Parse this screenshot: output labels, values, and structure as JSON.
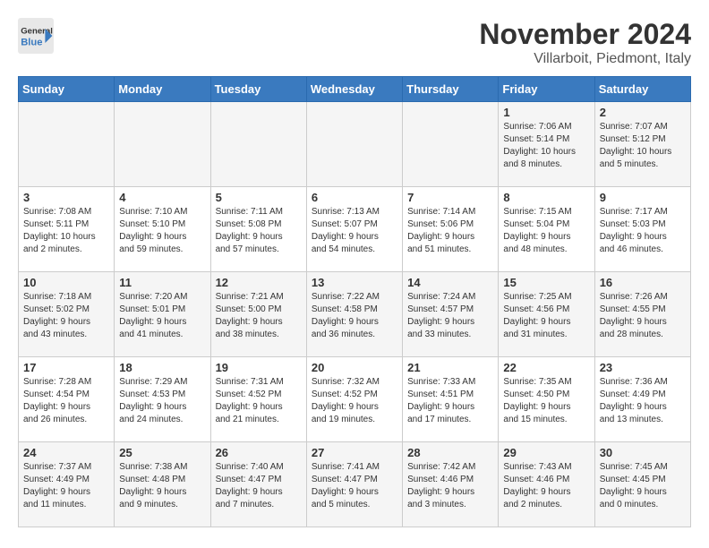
{
  "logo": {
    "text_general": "General",
    "text_blue": "Blue"
  },
  "title": "November 2024",
  "subtitle": "Villarboit, Piedmont, Italy",
  "weekdays": [
    "Sunday",
    "Monday",
    "Tuesday",
    "Wednesday",
    "Thursday",
    "Friday",
    "Saturday"
  ],
  "weeks": [
    [
      {
        "day": "",
        "info": ""
      },
      {
        "day": "",
        "info": ""
      },
      {
        "day": "",
        "info": ""
      },
      {
        "day": "",
        "info": ""
      },
      {
        "day": "",
        "info": ""
      },
      {
        "day": "1",
        "info": "Sunrise: 7:06 AM\nSunset: 5:14 PM\nDaylight: 10 hours\nand 8 minutes."
      },
      {
        "day": "2",
        "info": "Sunrise: 7:07 AM\nSunset: 5:12 PM\nDaylight: 10 hours\nand 5 minutes."
      }
    ],
    [
      {
        "day": "3",
        "info": "Sunrise: 7:08 AM\nSunset: 5:11 PM\nDaylight: 10 hours\nand 2 minutes."
      },
      {
        "day": "4",
        "info": "Sunrise: 7:10 AM\nSunset: 5:10 PM\nDaylight: 9 hours\nand 59 minutes."
      },
      {
        "day": "5",
        "info": "Sunrise: 7:11 AM\nSunset: 5:08 PM\nDaylight: 9 hours\nand 57 minutes."
      },
      {
        "day": "6",
        "info": "Sunrise: 7:13 AM\nSunset: 5:07 PM\nDaylight: 9 hours\nand 54 minutes."
      },
      {
        "day": "7",
        "info": "Sunrise: 7:14 AM\nSunset: 5:06 PM\nDaylight: 9 hours\nand 51 minutes."
      },
      {
        "day": "8",
        "info": "Sunrise: 7:15 AM\nSunset: 5:04 PM\nDaylight: 9 hours\nand 48 minutes."
      },
      {
        "day": "9",
        "info": "Sunrise: 7:17 AM\nSunset: 5:03 PM\nDaylight: 9 hours\nand 46 minutes."
      }
    ],
    [
      {
        "day": "10",
        "info": "Sunrise: 7:18 AM\nSunset: 5:02 PM\nDaylight: 9 hours\nand 43 minutes."
      },
      {
        "day": "11",
        "info": "Sunrise: 7:20 AM\nSunset: 5:01 PM\nDaylight: 9 hours\nand 41 minutes."
      },
      {
        "day": "12",
        "info": "Sunrise: 7:21 AM\nSunset: 5:00 PM\nDaylight: 9 hours\nand 38 minutes."
      },
      {
        "day": "13",
        "info": "Sunrise: 7:22 AM\nSunset: 4:58 PM\nDaylight: 9 hours\nand 36 minutes."
      },
      {
        "day": "14",
        "info": "Sunrise: 7:24 AM\nSunset: 4:57 PM\nDaylight: 9 hours\nand 33 minutes."
      },
      {
        "day": "15",
        "info": "Sunrise: 7:25 AM\nSunset: 4:56 PM\nDaylight: 9 hours\nand 31 minutes."
      },
      {
        "day": "16",
        "info": "Sunrise: 7:26 AM\nSunset: 4:55 PM\nDaylight: 9 hours\nand 28 minutes."
      }
    ],
    [
      {
        "day": "17",
        "info": "Sunrise: 7:28 AM\nSunset: 4:54 PM\nDaylight: 9 hours\nand 26 minutes."
      },
      {
        "day": "18",
        "info": "Sunrise: 7:29 AM\nSunset: 4:53 PM\nDaylight: 9 hours\nand 24 minutes."
      },
      {
        "day": "19",
        "info": "Sunrise: 7:31 AM\nSunset: 4:52 PM\nDaylight: 9 hours\nand 21 minutes."
      },
      {
        "day": "20",
        "info": "Sunrise: 7:32 AM\nSunset: 4:52 PM\nDaylight: 9 hours\nand 19 minutes."
      },
      {
        "day": "21",
        "info": "Sunrise: 7:33 AM\nSunset: 4:51 PM\nDaylight: 9 hours\nand 17 minutes."
      },
      {
        "day": "22",
        "info": "Sunrise: 7:35 AM\nSunset: 4:50 PM\nDaylight: 9 hours\nand 15 minutes."
      },
      {
        "day": "23",
        "info": "Sunrise: 7:36 AM\nSunset: 4:49 PM\nDaylight: 9 hours\nand 13 minutes."
      }
    ],
    [
      {
        "day": "24",
        "info": "Sunrise: 7:37 AM\nSunset: 4:49 PM\nDaylight: 9 hours\nand 11 minutes."
      },
      {
        "day": "25",
        "info": "Sunrise: 7:38 AM\nSunset: 4:48 PM\nDaylight: 9 hours\nand 9 minutes."
      },
      {
        "day": "26",
        "info": "Sunrise: 7:40 AM\nSunset: 4:47 PM\nDaylight: 9 hours\nand 7 minutes."
      },
      {
        "day": "27",
        "info": "Sunrise: 7:41 AM\nSunset: 4:47 PM\nDaylight: 9 hours\nand 5 minutes."
      },
      {
        "day": "28",
        "info": "Sunrise: 7:42 AM\nSunset: 4:46 PM\nDaylight: 9 hours\nand 3 minutes."
      },
      {
        "day": "29",
        "info": "Sunrise: 7:43 AM\nSunset: 4:46 PM\nDaylight: 9 hours\nand 2 minutes."
      },
      {
        "day": "30",
        "info": "Sunrise: 7:45 AM\nSunset: 4:45 PM\nDaylight: 9 hours\nand 0 minutes."
      }
    ]
  ]
}
